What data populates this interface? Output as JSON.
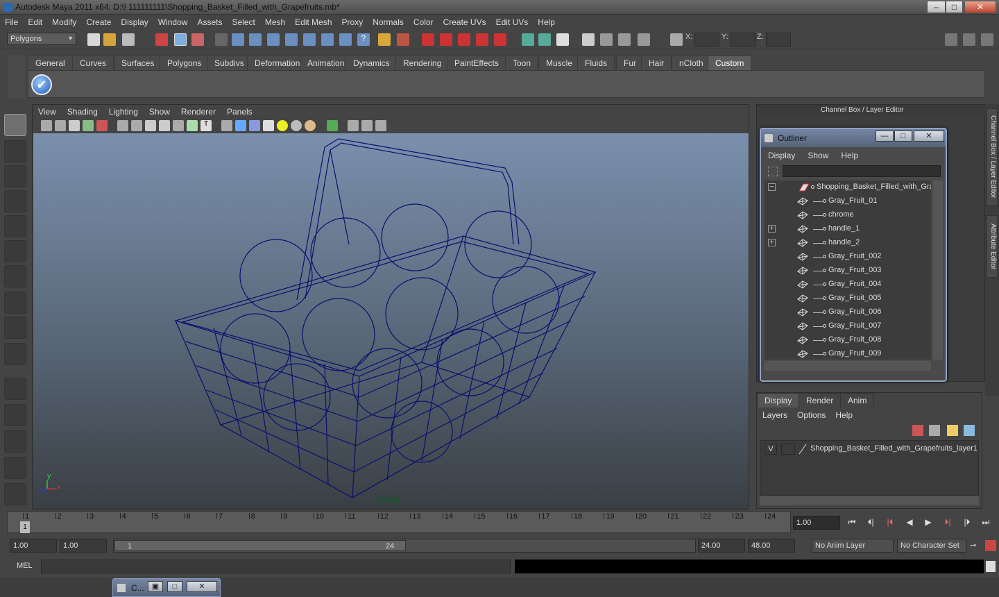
{
  "window": {
    "title": "Autodesk Maya 2011 x64: D:\\! 111111111\\Shopping_Basket_Filled_with_Grapefruits.mb*",
    "min": "–",
    "max": "□",
    "close": "✕"
  },
  "menubar": [
    "File",
    "Edit",
    "Modify",
    "Create",
    "Display",
    "Window",
    "Assets",
    "Select",
    "Mesh",
    "Edit Mesh",
    "Proxy",
    "Normals",
    "Color",
    "Create UVs",
    "Edit UVs",
    "Help"
  ],
  "status": {
    "menuset": "Polygons",
    "x_label": "X:",
    "y_label": "Y:",
    "z_label": "Z:"
  },
  "shelf": {
    "tabs": [
      "General",
      "Curves",
      "Surfaces",
      "Polygons",
      "Subdivs",
      "Deformation",
      "Animation",
      "Dynamics",
      "Rendering",
      "PaintEffects",
      "Toon",
      "Muscle",
      "Fluids",
      "Fur",
      "Hair",
      "nCloth",
      "Custom"
    ],
    "active": "Custom",
    "check": "✔"
  },
  "viewport": {
    "menu": [
      "View",
      "Shading",
      "Lighting",
      "Show",
      "Renderer",
      "Panels"
    ],
    "camera": "persp",
    "axis_y": "y",
    "axis_x": "x",
    "wire_color": "#0b0f6e"
  },
  "channelbox": {
    "title": "Channel Box / Layer Editor"
  },
  "right_tabs": {
    "channel": "Channel Box / Layer Editor",
    "attr": "Attribute Editor"
  },
  "outliner": {
    "title": "Outliner",
    "min": "—",
    "max": "□",
    "close": "✕",
    "menu": [
      "Display",
      "Show",
      "Help"
    ],
    "root": "Shopping_Basket_Filled_with_Grap",
    "items": [
      {
        "label": "Gray_Fruit_01",
        "expand": ""
      },
      {
        "label": "chrome",
        "expand": ""
      },
      {
        "label": "handle_1",
        "expand": "+"
      },
      {
        "label": "handle_2",
        "expand": "+"
      },
      {
        "label": "Gray_Fruit_002",
        "expand": ""
      },
      {
        "label": "Gray_Fruit_003",
        "expand": ""
      },
      {
        "label": "Gray_Fruit_004",
        "expand": ""
      },
      {
        "label": "Gray_Fruit_005",
        "expand": ""
      },
      {
        "label": "Gray_Fruit_006",
        "expand": ""
      },
      {
        "label": "Gray_Fruit_007",
        "expand": ""
      },
      {
        "label": "Gray_Fruit_008",
        "expand": ""
      },
      {
        "label": "Gray_Fruit_009",
        "expand": ""
      }
    ],
    "root_expand": "−"
  },
  "layer_editor": {
    "tabs": [
      "Display",
      "Render",
      "Anim"
    ],
    "menu": [
      "Layers",
      "Options",
      "Help"
    ],
    "layer": {
      "visible": "V",
      "name": "Shopping_Basket_Filled_with_Grapefruits_layer1"
    }
  },
  "timeline": {
    "ticks": [
      "1",
      "2",
      "3",
      "4",
      "5",
      "6",
      "7",
      "8",
      "9",
      "10",
      "11",
      "12",
      "13",
      "14",
      "15",
      "16",
      "17",
      "18",
      "19",
      "20",
      "21",
      "22",
      "23",
      "24"
    ],
    "current_frame": "1",
    "frame_field": "1.00",
    "playback": [
      "|◀◀",
      "|◀",
      "|◀",
      "◀",
      "▶",
      "▶|",
      "▶▶|",
      "▶▶|"
    ]
  },
  "range": {
    "start": "1.00",
    "start2": "1.00",
    "slider_start": "1",
    "slider_end": "24",
    "end": "24.00",
    "end2": "48.00",
    "anim_layer": "No Anim Layer",
    "char_set": "No Character Set"
  },
  "cmdline": {
    "label": "MEL"
  },
  "mini_window": {
    "label": "C..."
  }
}
